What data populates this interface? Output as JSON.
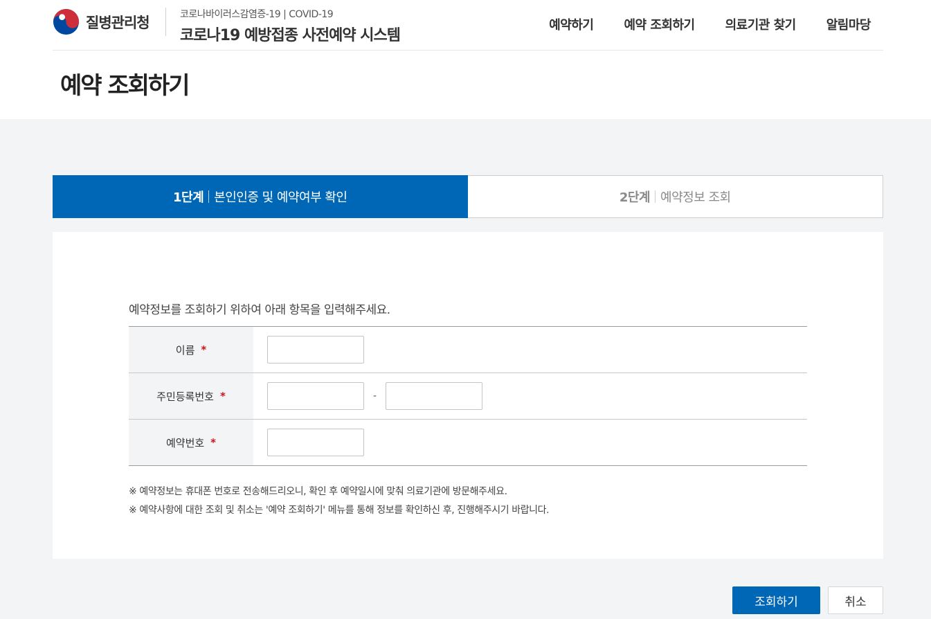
{
  "header": {
    "org_name": "질병관리청",
    "system_subtitle": "코로나바이러스감염증-19 | COVID-19",
    "system_title": "코로나19 예방접종 사전예약 시스템",
    "nav": [
      {
        "label": "예약하기"
      },
      {
        "label": "예약 조회하기"
      },
      {
        "label": "의료기관 찾기"
      },
      {
        "label": "알림마당"
      }
    ]
  },
  "page": {
    "title": "예약 조회하기"
  },
  "steps": [
    {
      "num": "1단계",
      "label": "본인인증 및 예약여부 확인",
      "active": true
    },
    {
      "num": "2단계",
      "label": "예약정보 조회",
      "active": false
    }
  ],
  "form": {
    "instruction": "예약정보를 조회하기 위하여 아래 항목을 입력해주세요.",
    "required_mark": "*",
    "fields": {
      "name": {
        "label": "이름",
        "value": ""
      },
      "rrn": {
        "label": "주민등록번호",
        "value_front": "",
        "value_back": "",
        "separator": "-"
      },
      "reservation": {
        "label": "예약번호",
        "value": ""
      }
    }
  },
  "notes": [
    "※ 예약정보는 휴대폰 번호로 전송해드리오니, 확인 후 예약일시에 맞춰 의료기관에 방문해주세요.",
    "※ 예약사항에 대한 조회 및 취소는 '예약 조회하기' 메뉴를 통해 정보를 확인하신 후, 진행해주시기 바랍니다."
  ],
  "actions": {
    "submit_label": "조회하기",
    "cancel_label": "취소"
  },
  "colors": {
    "primary": "#0067b6",
    "required": "#d0121b",
    "logo_red": "#cd2e3a",
    "logo_blue": "#0047a0"
  },
  "icons": {
    "logo": "kdca-taegeuk-logo-icon"
  }
}
